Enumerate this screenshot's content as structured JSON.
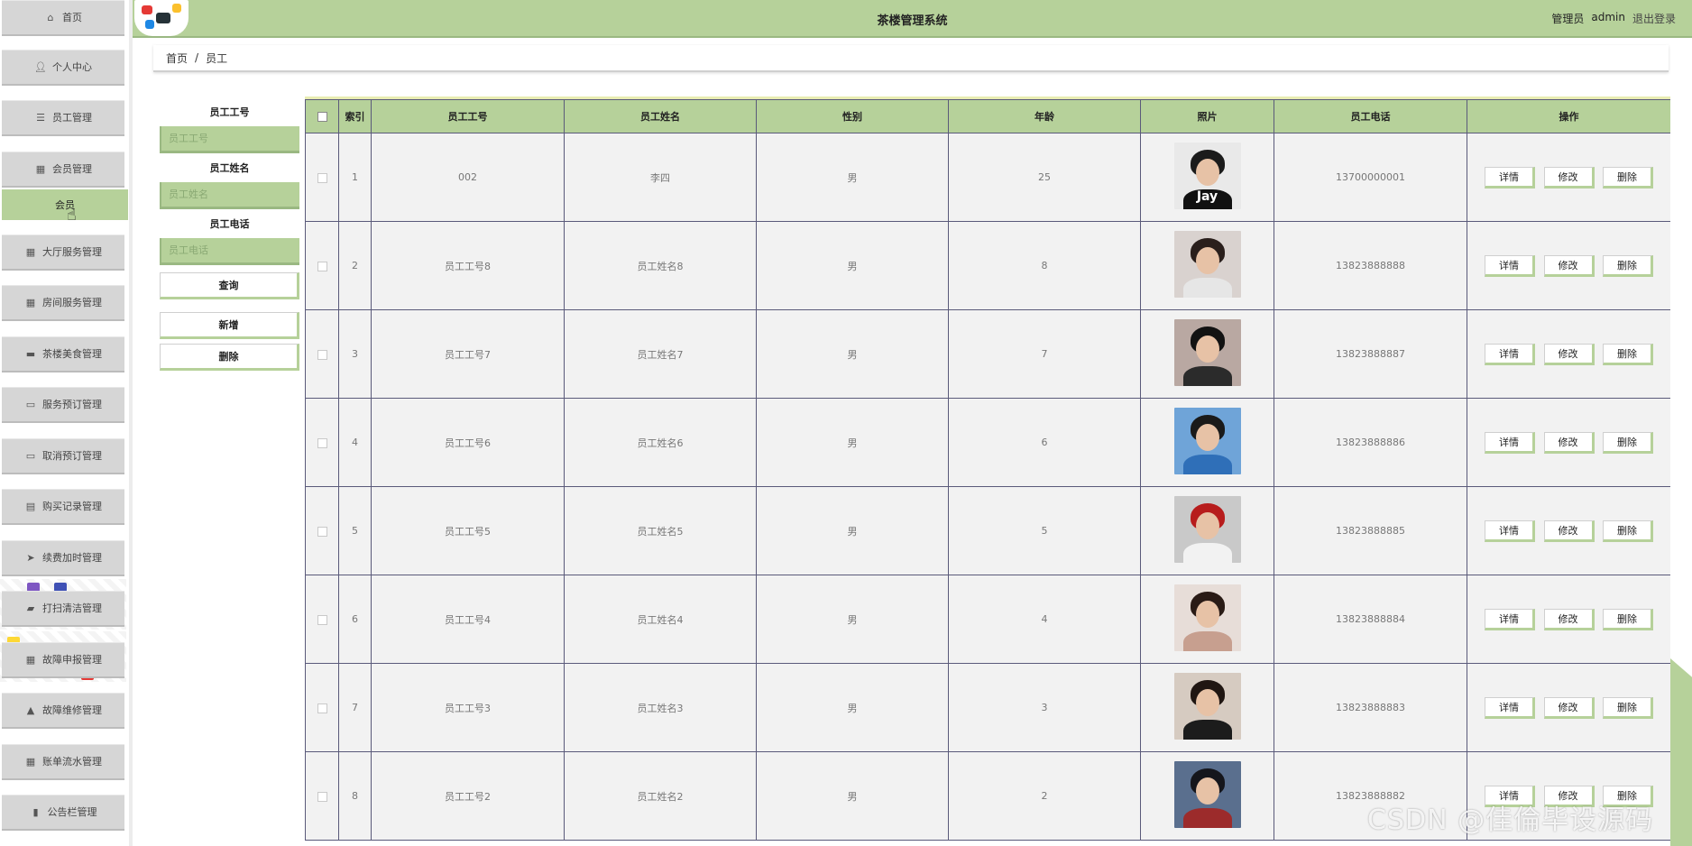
{
  "header": {
    "title": "茶楼管理系统",
    "user_role": "管理员",
    "username": "admin",
    "logout": "退出登录"
  },
  "sidebar": {
    "items": [
      {
        "label": "首页",
        "icon": "home-icon"
      },
      {
        "label": "个人中心",
        "icon": "user-icon"
      },
      {
        "label": "员工管理",
        "icon": "list-icon"
      },
      {
        "label": "会员管理",
        "icon": "grid-icon"
      },
      {
        "label": "大厅服务管理",
        "icon": "grid-icon"
      },
      {
        "label": "房间服务管理",
        "icon": "grid-icon"
      },
      {
        "label": "茶楼美食管理",
        "icon": "chat-icon"
      },
      {
        "label": "服务预订管理",
        "icon": "monitor-icon"
      },
      {
        "label": "取消预订管理",
        "icon": "monitor-icon"
      },
      {
        "label": "购买记录管理",
        "icon": "clipboard-icon"
      },
      {
        "label": "续费加时管理",
        "icon": "send-icon"
      },
      {
        "label": "打扫清洁管理",
        "icon": "ticket-icon"
      },
      {
        "label": "故障申报管理",
        "icon": "grid-icon"
      },
      {
        "label": "故障维修管理",
        "icon": "thumb-icon"
      },
      {
        "label": "账单流水管理",
        "icon": "table-icon"
      },
      {
        "label": "公告栏管理",
        "icon": "chart-icon"
      }
    ],
    "sub_item": "会员"
  },
  "breadcrumb": {
    "home": "首页",
    "separator": "/",
    "current": "员工"
  },
  "search": {
    "fields": [
      {
        "label": "员工工号",
        "placeholder": "员工工号"
      },
      {
        "label": "员工姓名",
        "placeholder": "员工姓名"
      },
      {
        "label": "员工电话",
        "placeholder": "员工电话"
      }
    ],
    "query_button": "查询",
    "add_button": "新增",
    "delete_button": "删除"
  },
  "table": {
    "columns": [
      "索引",
      "员工工号",
      "员工姓名",
      "性别",
      "年龄",
      "照片",
      "员工电话",
      "操作"
    ],
    "actions": {
      "detail": "详情",
      "edit": "修改",
      "delete": "删除"
    },
    "rows": [
      {
        "index": "1",
        "id": "002",
        "name": "李四",
        "gender": "男",
        "age": "25",
        "phone": "13700000001",
        "photo_text": "Jay"
      },
      {
        "index": "2",
        "id": "员工工号8",
        "name": "员工姓名8",
        "gender": "男",
        "age": "8",
        "phone": "13823888888",
        "photo_text": ""
      },
      {
        "index": "3",
        "id": "员工工号7",
        "name": "员工姓名7",
        "gender": "男",
        "age": "7",
        "phone": "13823888887",
        "photo_text": ""
      },
      {
        "index": "4",
        "id": "员工工号6",
        "name": "员工姓名6",
        "gender": "男",
        "age": "6",
        "phone": "13823888886",
        "photo_text": ""
      },
      {
        "index": "5",
        "id": "员工工号5",
        "name": "员工姓名5",
        "gender": "男",
        "age": "5",
        "phone": "13823888885",
        "photo_text": ""
      },
      {
        "index": "6",
        "id": "员工工号4",
        "name": "员工姓名4",
        "gender": "男",
        "age": "4",
        "phone": "13823888884",
        "photo_text": ""
      },
      {
        "index": "7",
        "id": "员工工号3",
        "name": "员工姓名3",
        "gender": "男",
        "age": "3",
        "phone": "13823888883",
        "photo_text": ""
      },
      {
        "index": "8",
        "id": "员工工号2",
        "name": "员工姓名2",
        "gender": "男",
        "age": "2",
        "phone": "13823888882",
        "photo_text": ""
      }
    ]
  },
  "watermark": "CSDN @佳倫毕设源码",
  "colors": {
    "accent": "#b6d19a",
    "accent_dark": "#9ab882",
    "menu_bg": "#d6d6d6",
    "cell_bg": "#f2f2f2",
    "border": "#5a5a7a"
  }
}
